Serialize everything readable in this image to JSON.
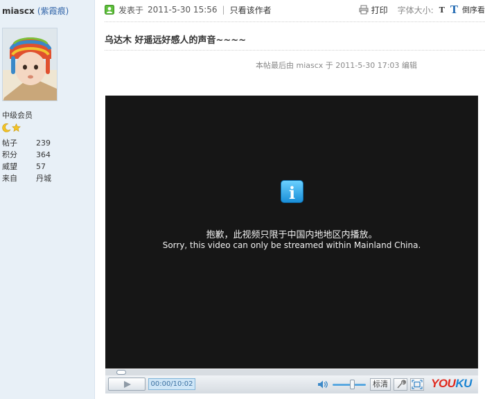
{
  "user": {
    "name": "miascx",
    "nickname": "(紫霞痕)",
    "rank": "中级会员",
    "stats": [
      {
        "label": "帖子",
        "value": "239"
      },
      {
        "label": "积分",
        "value": "364"
      },
      {
        "label": "威望",
        "value": "57"
      },
      {
        "label": "来自",
        "value": "丹城"
      }
    ]
  },
  "post": {
    "posted_label": "发表于",
    "posted_time": "2011-5-30 15:56",
    "author_only": "只看该作者",
    "print_label": "打印",
    "font_size_label": "字体大小:",
    "font_small": "T",
    "font_big": "T",
    "reverse_label": "倒序看",
    "title": "乌达木  好遥远好感人的声音~~~~",
    "edit_note": "本帖最后由 miascx 于 2011-5-30 17:03 编辑"
  },
  "player": {
    "info_glyph": "i",
    "message_cn": "抱歉，此视频只限于中国内地地区内播放。",
    "message_en": "Sorry, this video can only be streamed within Mainland China.",
    "time": "00:00/10:02",
    "quality_label": "标清",
    "brand_red": "YOU",
    "brand_blue": "KU"
  },
  "colors": {
    "sidebar_bg": "#e8f0f7",
    "player_bg": "#161616",
    "accent_blue": "#2a6fb5",
    "brand_red": "#e0281c"
  }
}
